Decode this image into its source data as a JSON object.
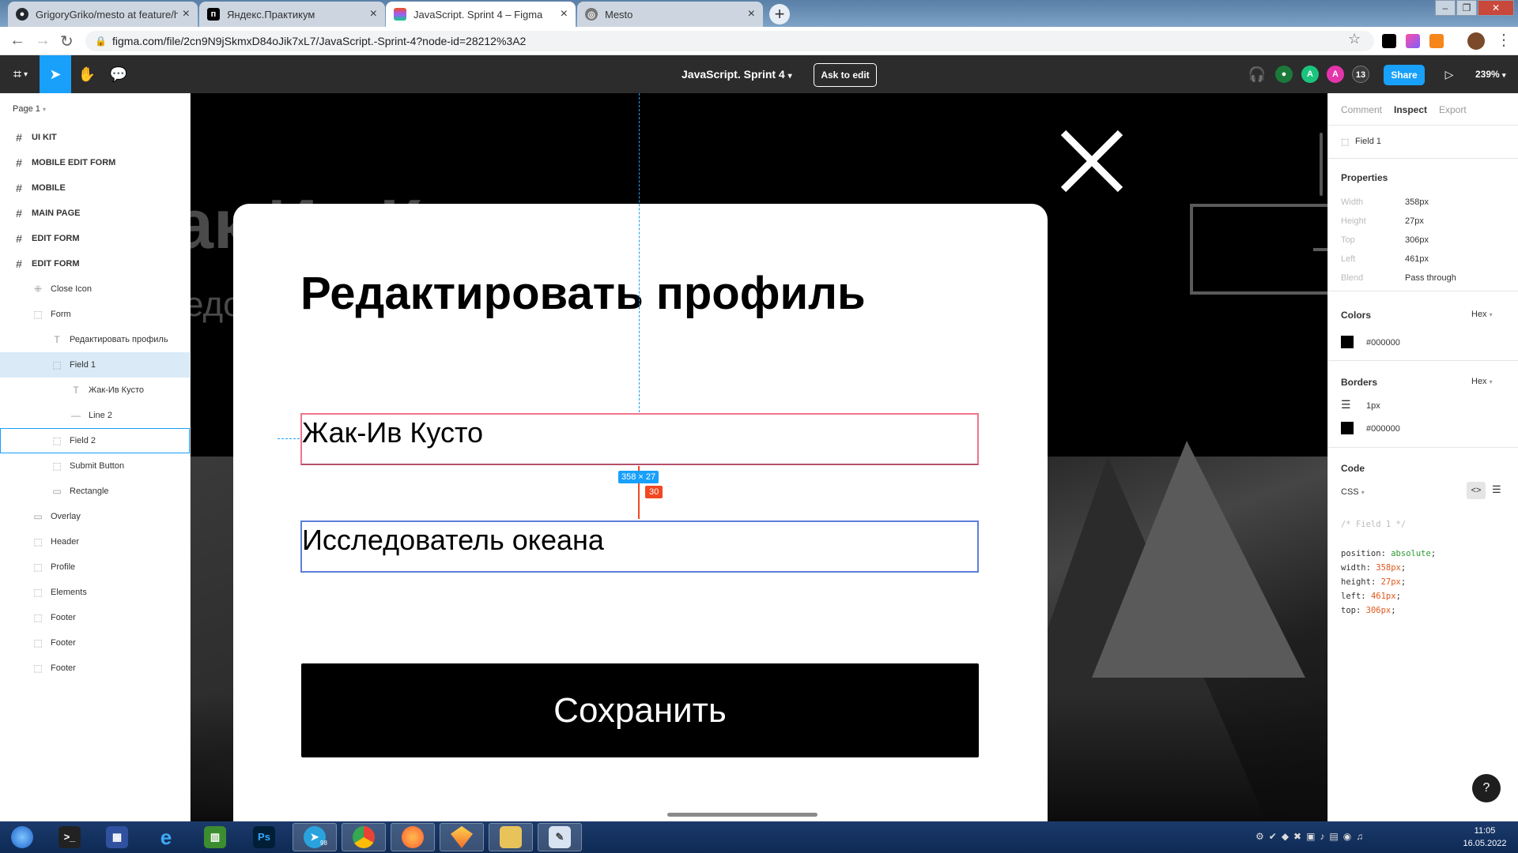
{
  "browser": {
    "tabs": [
      {
        "title": "GrigoryGriko/mesto at feature/h",
        "icon": "github-icon",
        "active": false
      },
      {
        "title": "Яндекс.Практикум",
        "icon": "praktikum-icon",
        "active": false
      },
      {
        "title": "JavaScript. Sprint 4 – Figma",
        "icon": "figma-icon",
        "active": true
      },
      {
        "title": "Mesto",
        "icon": "globe-icon",
        "active": false
      }
    ],
    "url": "figma.com/file/2cn9N9jSkmxD84oJik7xL7/JavaScript.-Sprint-4?node-id=28212%3A2"
  },
  "figma_toolbar": {
    "file_title": "JavaScript. Sprint 4",
    "ask_to_edit": "Ask to edit",
    "share": "Share",
    "zoom": "239%",
    "avatar_a1": "A",
    "avatar_a2": "A",
    "collab_count": "13"
  },
  "left_panel": {
    "page": "Page 1",
    "layers": [
      {
        "label": "UI KIT",
        "icon": "frame-icon",
        "depth": 0
      },
      {
        "label": "MOBILE EDIT FORM",
        "icon": "frame-icon",
        "depth": 0
      },
      {
        "label": "MOBILE",
        "icon": "frame-icon",
        "depth": 0
      },
      {
        "label": "MAIN PAGE",
        "icon": "frame-icon",
        "depth": 0
      },
      {
        "label": "EDIT FORM",
        "icon": "frame-icon",
        "depth": 0
      },
      {
        "label": "EDIT FORM",
        "icon": "frame-icon",
        "depth": 0
      },
      {
        "label": "Close Icon",
        "icon": "component-icon",
        "depth": 1
      },
      {
        "label": "Form",
        "icon": "group-icon",
        "depth": 1
      },
      {
        "label": "Редактировать профиль",
        "icon": "text-icon",
        "depth": 2
      },
      {
        "label": "Field 1",
        "icon": "group-icon",
        "depth": 2,
        "selected": true
      },
      {
        "label": "Жак-Ив Кусто",
        "icon": "text-icon",
        "depth": 3
      },
      {
        "label": "Line 2",
        "icon": "line-icon",
        "depth": 3
      },
      {
        "label": "Field 2",
        "icon": "group-icon",
        "depth": 2,
        "hover": true
      },
      {
        "label": "Submit Button",
        "icon": "group-icon",
        "depth": 2
      },
      {
        "label": "Rectangle",
        "icon": "rectangle-icon",
        "depth": 2
      },
      {
        "label": "Overlay",
        "icon": "rectangle-icon",
        "depth": 1
      },
      {
        "label": "Header",
        "icon": "group-icon",
        "depth": 1
      },
      {
        "label": "Profile",
        "icon": "group-icon",
        "depth": 1
      },
      {
        "label": "Elements",
        "icon": "group-icon",
        "depth": 1
      },
      {
        "label": "Footer",
        "icon": "group-icon",
        "depth": 1
      },
      {
        "label": "Footer",
        "icon": "group-icon",
        "depth": 1
      },
      {
        "label": "Footer",
        "icon": "group-icon",
        "depth": 1
      }
    ]
  },
  "canvas": {
    "bg_text_1": "ак Ив К",
    "bg_text_2": "едо",
    "modal_title": "Редактировать профиль",
    "field1_value": "Жак-Ив Кусто",
    "field2_value": "Исследователь океана",
    "save_button": "Сохранить",
    "size_badge": "358 × 27",
    "spacing_badge": "30"
  },
  "right_panel": {
    "tabs": [
      "Comment",
      "Inspect",
      "Export"
    ],
    "active_tab": "Inspect",
    "layer_name": "Field 1",
    "properties_title": "Properties",
    "properties": [
      {
        "key": "Width",
        "value": "358px"
      },
      {
        "key": "Height",
        "value": "27px"
      },
      {
        "key": "Top",
        "value": "306px"
      },
      {
        "key": "Left",
        "value": "461px"
      },
      {
        "key": "Blend",
        "value": "Pass through"
      }
    ],
    "colors_title": "Colors",
    "colors_format": "Hex",
    "color_value": "#000000",
    "borders_title": "Borders",
    "borders_format": "Hex",
    "border_width": "1px",
    "border_color": "#000000",
    "code_title": "Code",
    "code_lang": "CSS",
    "code_comment": "/* Field 1 */",
    "code_lines": [
      {
        "prop": "position",
        "value": "absolute"
      },
      {
        "prop": "width",
        "value": "358px"
      },
      {
        "prop": "height",
        "value": "27px"
      },
      {
        "prop": "left",
        "value": "461px"
      },
      {
        "prop": "top",
        "value": "306px"
      }
    ],
    "help": "?"
  },
  "taskbar": {
    "time": "11:05",
    "date": "16.05.2022",
    "apps": [
      "start-orb",
      "terminal-icon",
      "save-icon",
      "ie-icon",
      "chart-app-icon",
      "photoshop-icon",
      "telegram-icon",
      "chrome-icon",
      "firefox-icon",
      "sketch-icon",
      "explorer-icon",
      "paint-icon"
    ],
    "photoshop_label": "Ps",
    "telegram_badge": "98"
  },
  "colors": {
    "figma_blue": "#18a0fb",
    "selection_bg": "#daebf7",
    "measure_red": "#f24822"
  }
}
